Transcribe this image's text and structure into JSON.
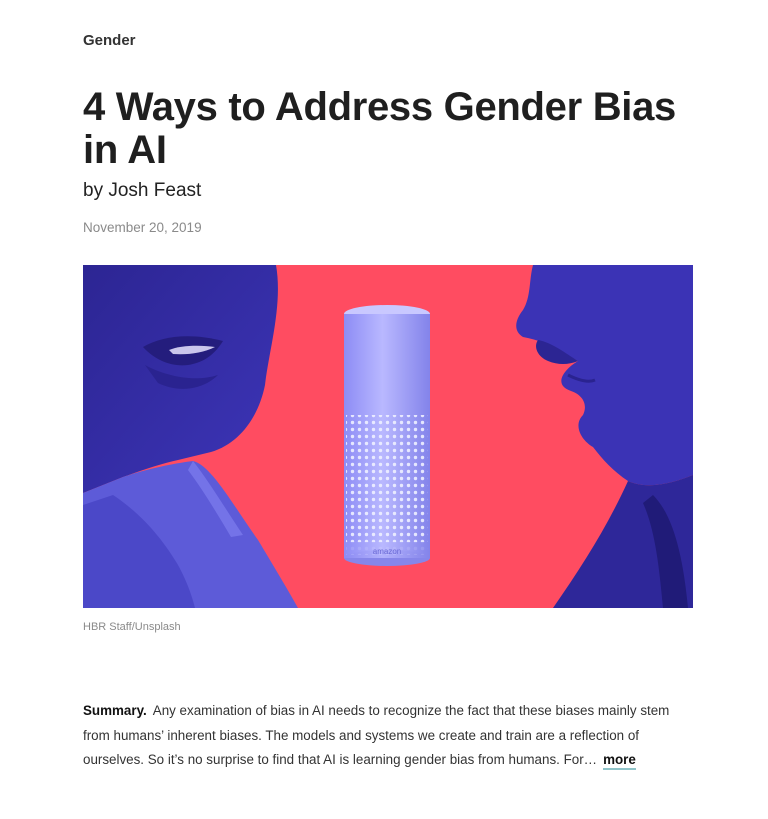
{
  "topic": "Gender",
  "title": "4 Ways to Address Gender Bias in AI",
  "byline": {
    "prefix": "by",
    "author": "Josh Feast"
  },
  "date": "November 20, 2019",
  "hero": {
    "alt": "Two faces facing a smart speaker",
    "speaker_brand": "amazon",
    "colors": {
      "background": "#ff4c61",
      "figure": "#3b33b5",
      "speaker": "#a9a9ff"
    }
  },
  "credit": "HBR Staff/Unsplash",
  "summary": {
    "label": "Summary.",
    "text": "Any examination of bias in AI needs to recognize the fact that these biases mainly stem from humans’ inherent biases. The models and systems we create and train are a reflection of ourselves. So it’s no surprise to find that AI is learning gender bias from humans. For…",
    "more_label": "more"
  }
}
